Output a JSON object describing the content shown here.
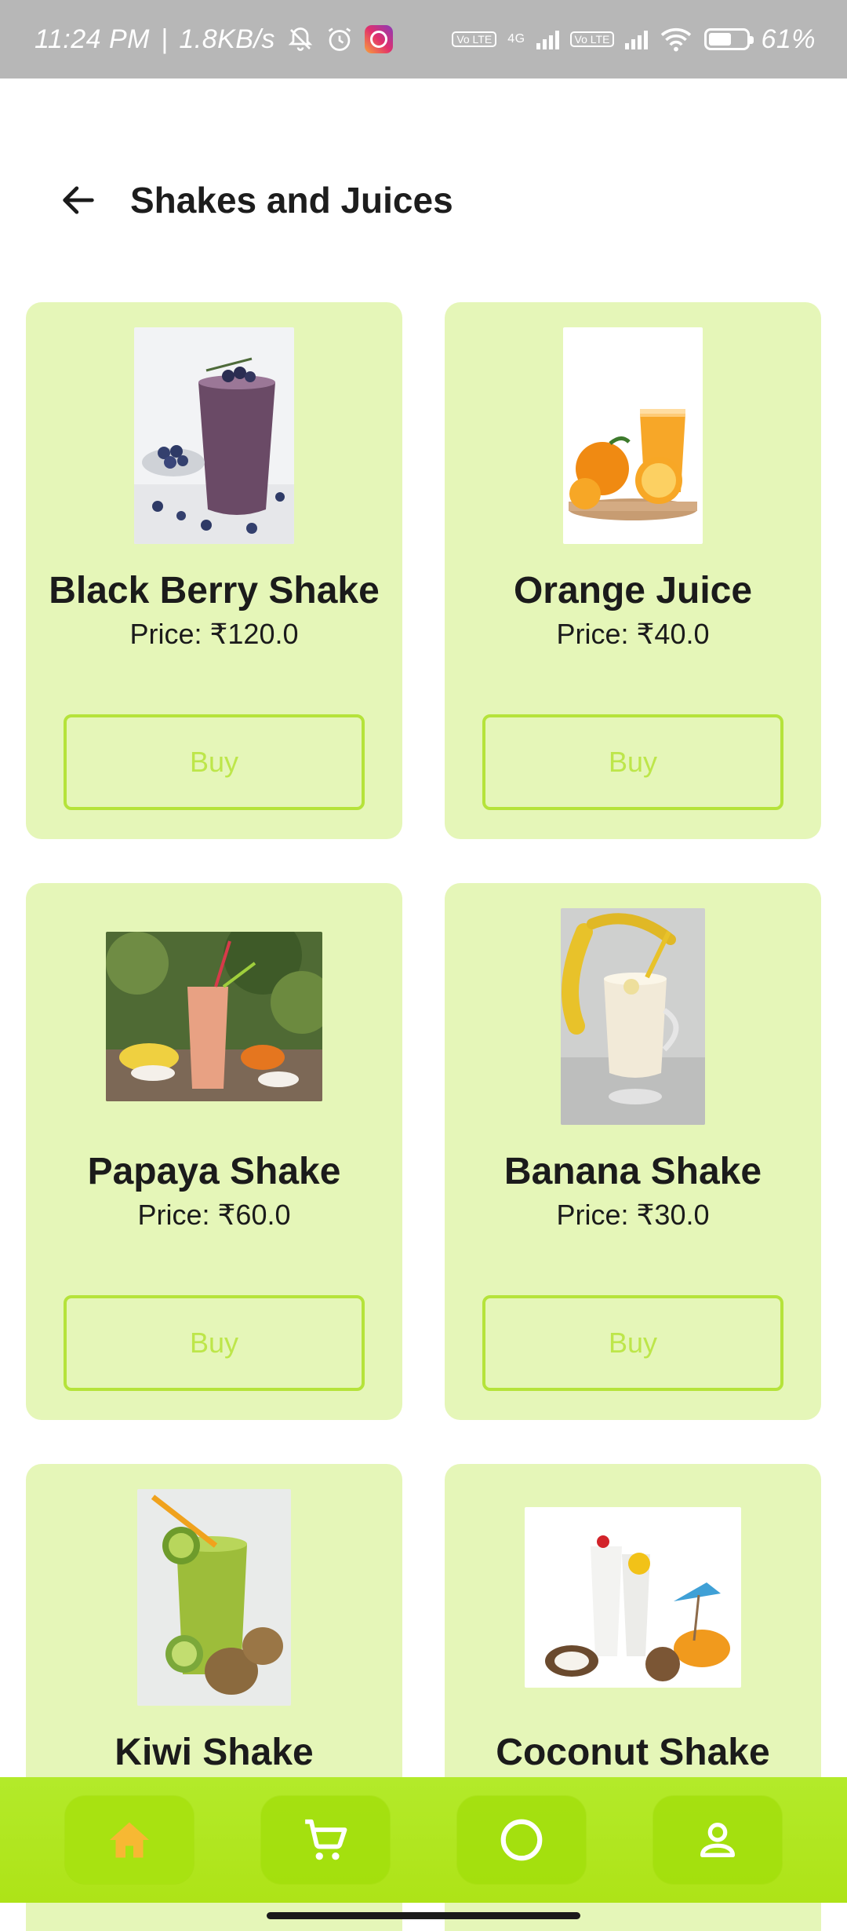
{
  "status_bar": {
    "time": "11:24 PM",
    "separator": "|",
    "data_rate": "1.8KB/s",
    "network_4g": "4G",
    "volte": "Vo LTE",
    "battery": "61%",
    "icons": [
      "mute-bell-icon",
      "alarm-icon",
      "instagram-icon",
      "signal-icon",
      "wifi-icon",
      "battery-icon"
    ],
    "battery_level": 0.61
  },
  "header": {
    "title": "Shakes and Juices",
    "back_icon": "arrow-left-icon"
  },
  "products": [
    {
      "name": "Black Berry Shake",
      "price": "Price: ₹120.0",
      "buy_label": "Buy"
    },
    {
      "name": "Orange Juice",
      "price": "Price: ₹40.0",
      "buy_label": "Buy"
    },
    {
      "name": "Papaya Shake",
      "price": "Price: ₹60.0",
      "buy_label": "Buy"
    },
    {
      "name": "Banana Shake",
      "price": "Price: ₹30.0",
      "buy_label": "Buy"
    },
    {
      "name": "Kiwi Shake",
      "price": "",
      "buy_label": ""
    },
    {
      "name": "Coconut Shake",
      "price": "",
      "buy_label": ""
    }
  ],
  "bottom_nav": {
    "items": [
      {
        "icon": "home-icon",
        "active": true
      },
      {
        "icon": "cart-icon",
        "active": false
      },
      {
        "icon": "circle-icon",
        "active": false
      },
      {
        "icon": "profile-icon",
        "active": false
      }
    ]
  },
  "colors": {
    "card_bg": "#e5f6b8",
    "accent": "#b5e33a",
    "nav_bg": "#b3ea2a",
    "home_active": "#f7b833"
  }
}
